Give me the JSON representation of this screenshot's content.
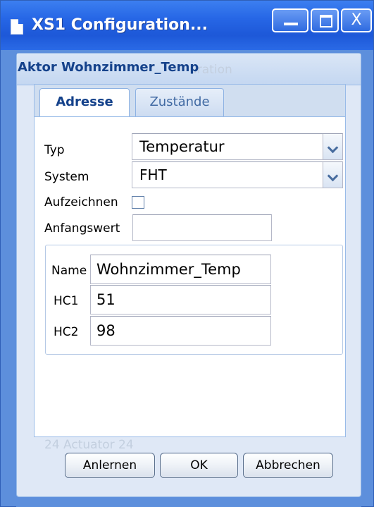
{
  "window": {
    "title": "XS1 Configuration...",
    "close_glyph": "X"
  },
  "panel": {
    "title": "Aktor Wohnzimmer_Temp",
    "background_ghost_title": "uration",
    "background_ghost_footer": "24    Actuator 24"
  },
  "tabs": [
    {
      "label": "Adresse",
      "active": true
    },
    {
      "label": "Zustände",
      "active": false
    }
  ],
  "form": {
    "typ_label": "Typ",
    "typ_value": "Temperatur",
    "system_label": "System",
    "system_value": "FHT",
    "aufzeichnen_label": "Aufzeichnen",
    "aufzeichnen_checked": false,
    "anfangswert_label": "Anfangswert",
    "anfangswert_value": ""
  },
  "fieldset": {
    "name_label": "Name",
    "name_value": "Wohnzimmer_Temp",
    "hc1_label": "HC1",
    "hc1_value": "51",
    "hc2_label": "HC2",
    "hc2_value": "98"
  },
  "buttons": {
    "anlernen": "Anlernen",
    "ok": "OK",
    "abbrechen": "Abbrechen"
  },
  "icons": {
    "window": "document-icon",
    "minimize": "minimize-icon",
    "maximize": "maximize-icon",
    "close": "close-icon",
    "dropdown": "chevron-down-icon"
  },
  "colors": {
    "titlebar": "#2767e6",
    "panel_title": "#15428b",
    "panel_bg": "#dfe8f6"
  }
}
